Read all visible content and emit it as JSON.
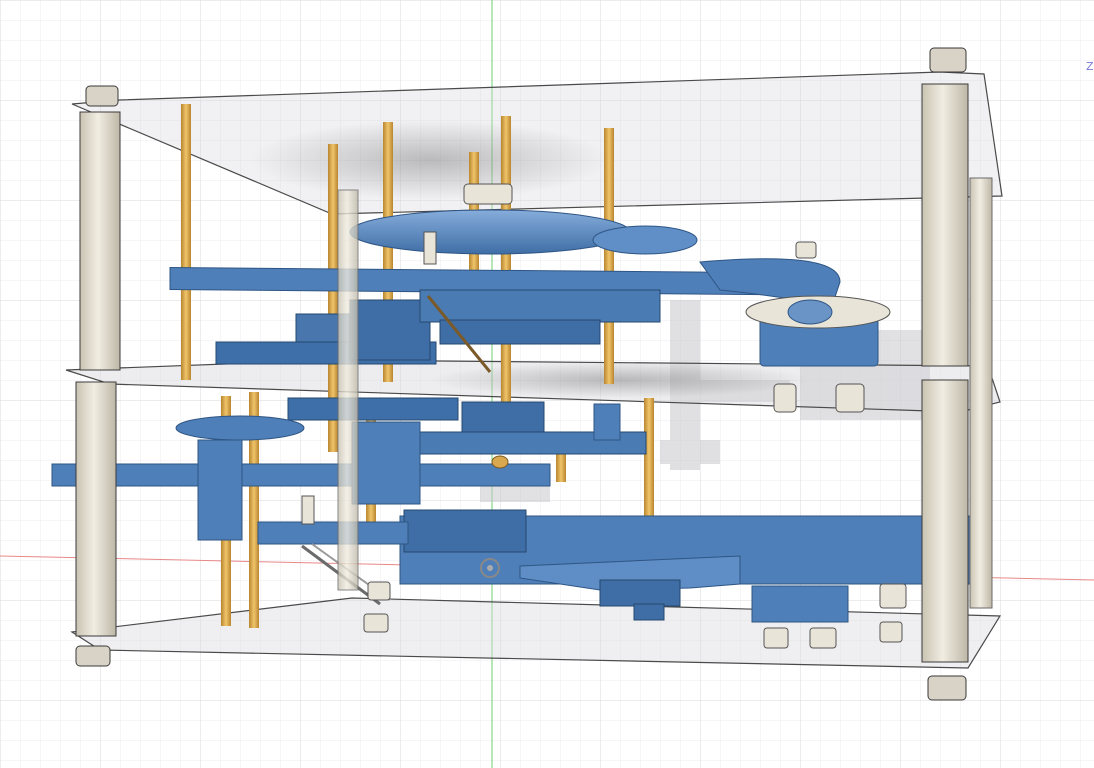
{
  "viewcube": {
    "axis_label": "Z"
  },
  "colors": {
    "background": "#ffffff",
    "grid_minor": "#e6e6ea",
    "grid_major": "#d3d3d9",
    "axis_x": "#e88888",
    "axis_y": "#6ccf6c",
    "part_blue": "#4f7fb8",
    "part_blue_dark": "#3b6699",
    "part_blue_light": "#79a3d4",
    "brass": "#d9a84f",
    "standoff": "#e6e1d2",
    "steel": "#cfcac0",
    "acrylic_fill": "rgba(215,215,220,0.35)",
    "acrylic_edge": "#555555"
  }
}
